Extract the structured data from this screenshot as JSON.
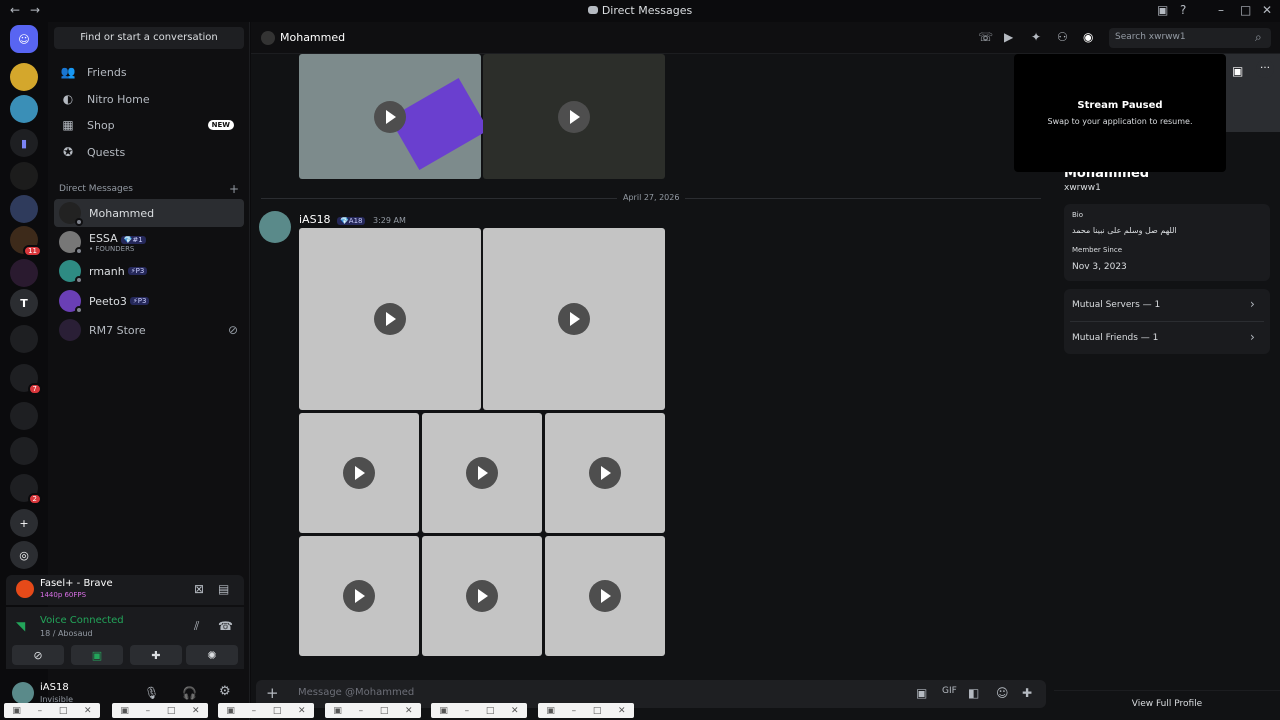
{
  "window": {
    "title": "Direct Messages",
    "back": "←",
    "forward": "→"
  },
  "sidebar": {
    "search_label": "Find or start a conversation",
    "nav": [
      {
        "label": "Friends",
        "icon": "friends-icon"
      },
      {
        "label": "Nitro Home",
        "icon": "nitro-icon"
      },
      {
        "label": "Shop",
        "icon": "shop-icon",
        "badge": "NEW"
      },
      {
        "label": "Quests",
        "icon": "quests-icon"
      }
    ],
    "dm_heading": "Direct Messages",
    "dms": [
      {
        "name": "Mohammed",
        "selected": true
      },
      {
        "name": "ESSA",
        "tag": "💎#1",
        "sub": "• FOUNDERS"
      },
      {
        "name": "rmanh",
        "tag": "⚡P3"
      },
      {
        "name": "Peeto3",
        "tag": "⚡P3"
      },
      {
        "name": "RM7 Store"
      }
    ]
  },
  "servers": {
    "badges": [
      "11",
      "7",
      "2"
    ]
  },
  "activity": {
    "title": "Fasel+ - Brave",
    "sub": "1440p 60FPS"
  },
  "voice": {
    "status": "Voice Connected",
    "channel": "18 / Abosaud"
  },
  "user": {
    "name": "iAS18",
    "status": "Invisible"
  },
  "chat": {
    "header_name": "Mohammed",
    "date_divider": "April 27, 2026",
    "message_author": "iAS18",
    "message_tag": "💎A18",
    "message_time": "3:29 AM",
    "composer_placeholder": "Message @Mohammed"
  },
  "search": {
    "placeholder": "Search xwrww1"
  },
  "stream": {
    "title": "Stream Paused",
    "subtitle": "Swap to your application to resume."
  },
  "profile": {
    "name": "Mohammed",
    "username": "xwrww1",
    "bio_label": "Bio",
    "bio_text": "اللهم صل وسلم على نبينا محمد",
    "member_since_label": "Member Since",
    "member_since": "Nov 3, 2023",
    "mutual_servers": "Mutual Servers — 1",
    "mutual_friends": "Mutual Friends — 1",
    "view_full": "View Full Profile"
  },
  "colors": {
    "accent": "#5865f2",
    "green": "#23a55a",
    "red": "#da373c"
  }
}
